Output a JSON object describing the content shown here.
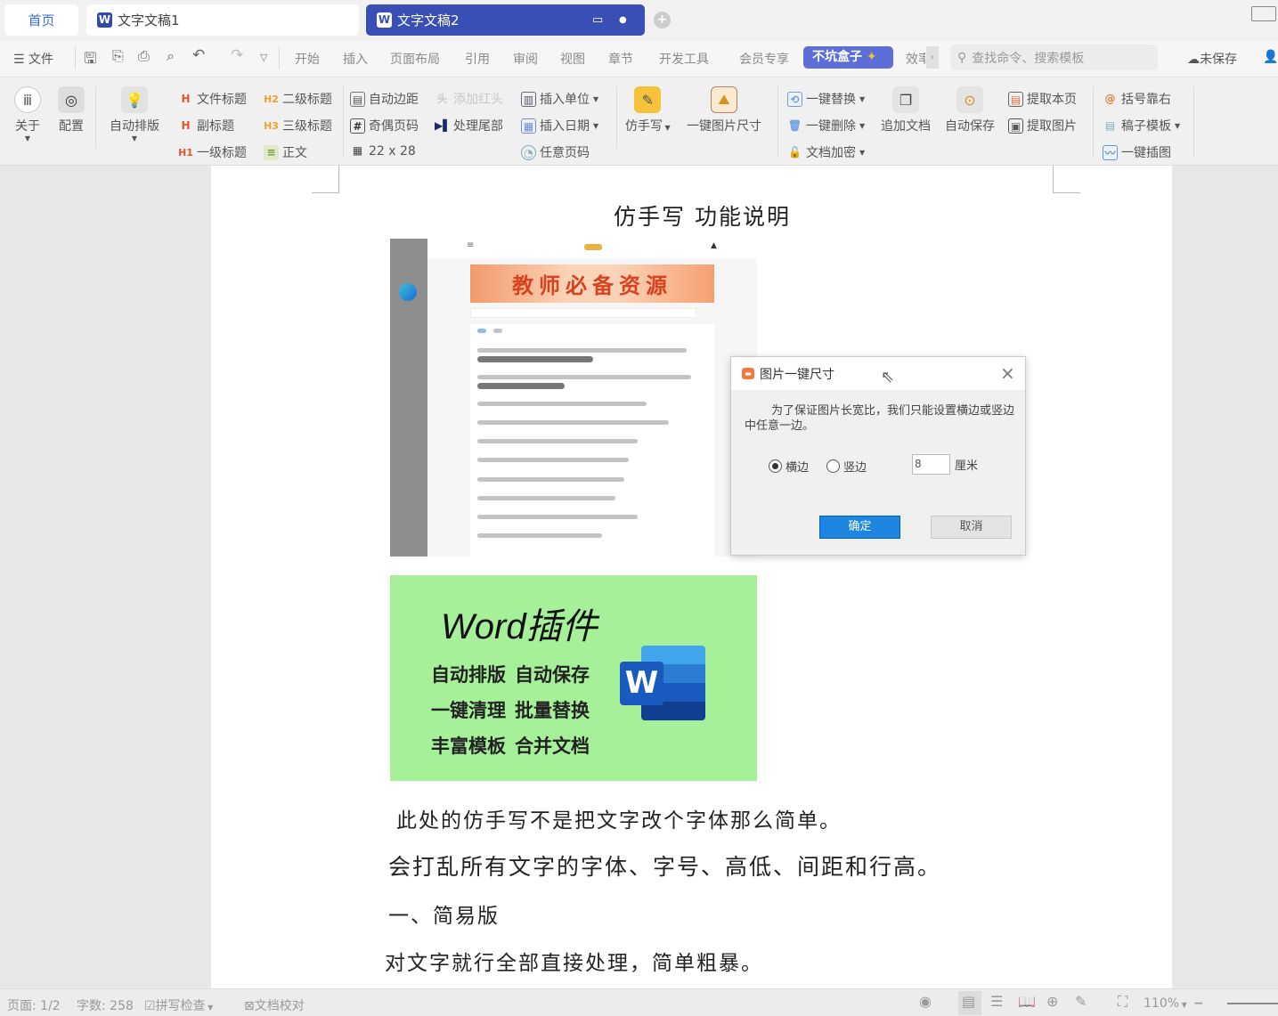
{
  "tabs": {
    "home": "首页",
    "doc1": "文字文稿1",
    "doc2": "文字文稿2",
    "accent": "#3a4fb5"
  },
  "menu": {
    "file": "文件",
    "tabs": [
      "开始",
      "插入",
      "页面布局",
      "引用",
      "审阅",
      "视图",
      "章节",
      "开发工具",
      "会员专享"
    ],
    "active_tab": "不坑盒子",
    "more": "效率",
    "search_placeholder": "查找命令、搜索模板",
    "unsaved": "未保存"
  },
  "ribbon": {
    "about": "关于",
    "config": "配置",
    "auto_layout": "自动排版",
    "headings": [
      "文件标题",
      "副标题",
      "一级标题",
      "二级标题",
      "三级标题",
      "正文"
    ],
    "page": [
      "自动边距",
      "奇偶页码",
      "22 x 28",
      "添加红头",
      "处理尾部"
    ],
    "insert": [
      "插入单位",
      "插入日期",
      "任意页码"
    ],
    "handwrite": "仿手写",
    "img_size": "一键图片尺寸",
    "edit": [
      "一键替换",
      "一键删除",
      "文档加密"
    ],
    "append_doc": "追加文档",
    "auto_save": "自动保存",
    "extract": [
      "提取本页",
      "提取图片"
    ],
    "misc": [
      "括号靠右",
      "稿子模板",
      "一键插图"
    ]
  },
  "document": {
    "title": "仿手写 功能说明",
    "embedded_banner": "教师必备资源",
    "promo": {
      "title": "Word插件",
      "features": [
        "自动排版",
        "自动保存",
        "一键清理",
        "批量替换",
        "丰富模板",
        "合并文档"
      ],
      "logo_letter": "W"
    },
    "paragraphs": [
      "此处的仿手写不是把文字改个字体那么简单。",
      "会打乱所有文字的字体、字号、高低、间距和行高。",
      "一、简易版",
      "对文字就行全部直接处理，简单粗暴。"
    ]
  },
  "dialog": {
    "title": "图片一键尺寸",
    "message": "为了保证图片长宽比，我们只能设置横边或竖边中任意一边。",
    "option_h": "横边",
    "option_v": "竖边",
    "selected": "横边",
    "value": "8",
    "unit": "厘米",
    "ok": "确定",
    "cancel": "取消"
  },
  "status": {
    "page": "页面: 1/2",
    "words": "字数: 258",
    "spell": "拼写检查",
    "proof": "文档校对",
    "zoom": "110%"
  }
}
